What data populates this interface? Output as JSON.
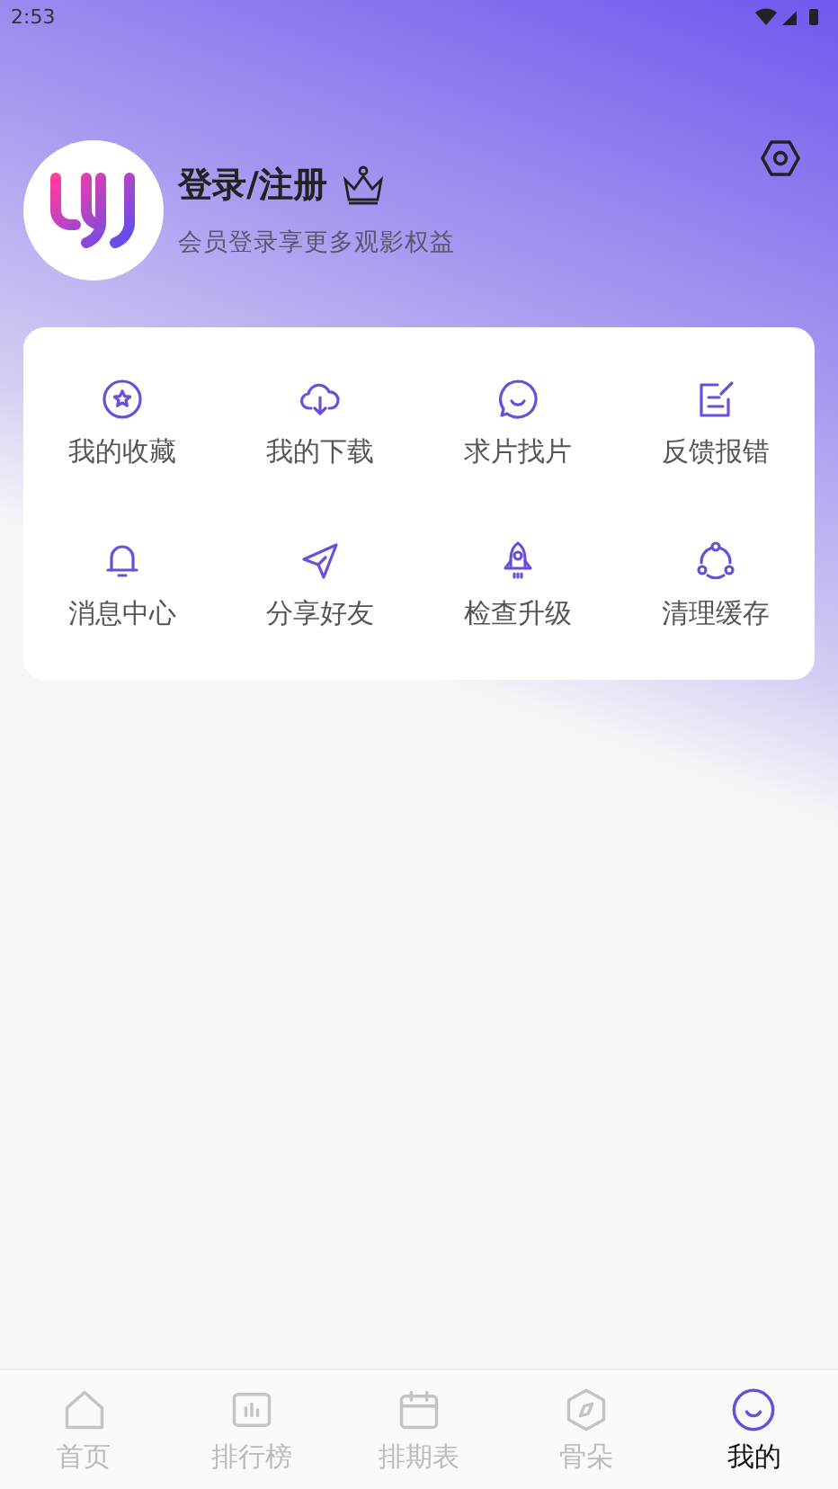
{
  "status_bar": {
    "time": "2:53"
  },
  "profile": {
    "title": "登录/注册",
    "subtitle": "会员登录享更多观影权益"
  },
  "menu": [
    {
      "label": "我的收藏",
      "kind": "star"
    },
    {
      "label": "我的下载",
      "kind": "download"
    },
    {
      "label": "求片找片",
      "kind": "chat"
    },
    {
      "label": "反馈报错",
      "kind": "edit"
    },
    {
      "label": "消息中心",
      "kind": "bell"
    },
    {
      "label": "分享好友",
      "kind": "send"
    },
    {
      "label": "检查升级",
      "kind": "rocket"
    },
    {
      "label": "清理缓存",
      "kind": "cycle"
    }
  ],
  "tabs": [
    {
      "label": "首页",
      "kind": "home",
      "selected": false
    },
    {
      "label": "排行榜",
      "kind": "chart",
      "selected": false
    },
    {
      "label": "排期表",
      "kind": "calendar",
      "selected": false
    },
    {
      "label": "骨朵",
      "kind": "compass",
      "selected": false
    },
    {
      "label": "我的",
      "kind": "smile",
      "selected": true
    }
  ]
}
